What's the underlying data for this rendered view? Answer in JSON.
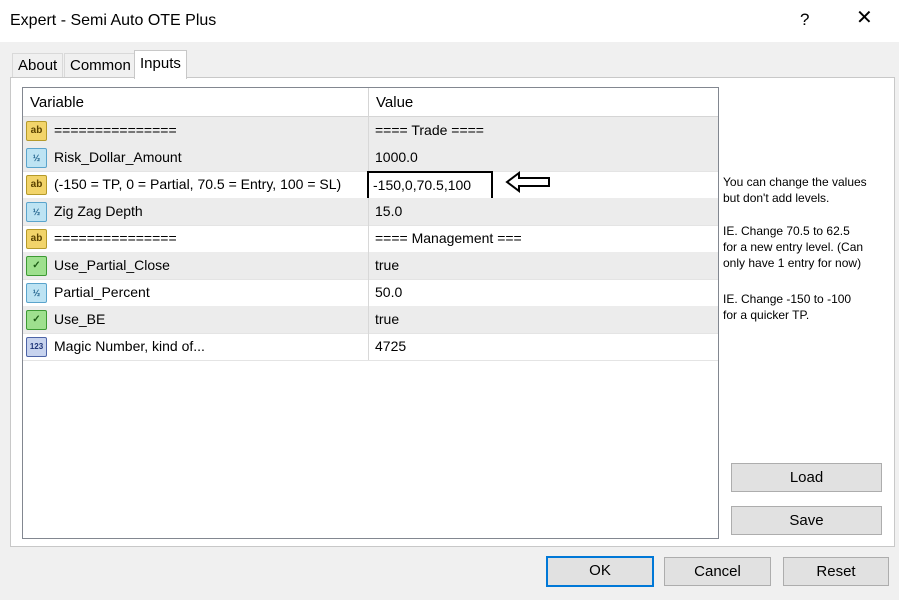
{
  "window": {
    "title": "Expert - Semi Auto OTE Plus",
    "help_glyph": "?",
    "close_glyph": "✕"
  },
  "tabs": [
    {
      "label": "About"
    },
    {
      "label": "Common"
    },
    {
      "label": "Inputs",
      "active": true
    }
  ],
  "grid": {
    "col_variable": "Variable",
    "col_value": "Value",
    "rows": [
      {
        "icon": "ab",
        "variable": "===============",
        "value": "==== Trade ===="
      },
      {
        "icon": "½",
        "variable": "Risk_Dollar_Amount",
        "value": "1000.0"
      },
      {
        "icon": "ab",
        "variable": "(-150 = TP, 0 = Partial, 70.5 = Entry, 100 = SL)",
        "value": "-150,0,70.5,100"
      },
      {
        "icon": "½",
        "variable": "Zig Zag Depth",
        "value": "15.0"
      },
      {
        "icon": "ab",
        "variable": "===============",
        "value": "==== Management ==="
      },
      {
        "icon": "✓",
        "variable": "Use_Partial_Close",
        "value": "true"
      },
      {
        "icon": "½",
        "variable": "Partial_Percent",
        "value": "50.0"
      },
      {
        "icon": "✓",
        "variable": "Use_BE",
        "value": "true"
      },
      {
        "icon": "123",
        "variable": "Magic Number, kind of...",
        "value": "4725"
      }
    ]
  },
  "annotations": {
    "note1_line1": "You can change the values",
    "note1_line2": "but don't add levels.",
    "note2_line1": "IE. Change 70.5 to 62.5",
    "note2_line2": "for a new entry level. (Can",
    "note2_line3": "only have 1 entry for now)",
    "note3_line1": "IE. Change -150 to -100",
    "note3_line2": "for a quicker TP."
  },
  "buttons": {
    "load": "Load",
    "save": "Save",
    "ok": "OK",
    "cancel": "Cancel",
    "reset": "Reset"
  },
  "colors": {
    "accent": "#0078d7",
    "string_icon": "#f2d46a",
    "double_icon": "#bde3f3",
    "bool_icon": "#9ee08e",
    "int_icon": "#c7d3ee"
  }
}
